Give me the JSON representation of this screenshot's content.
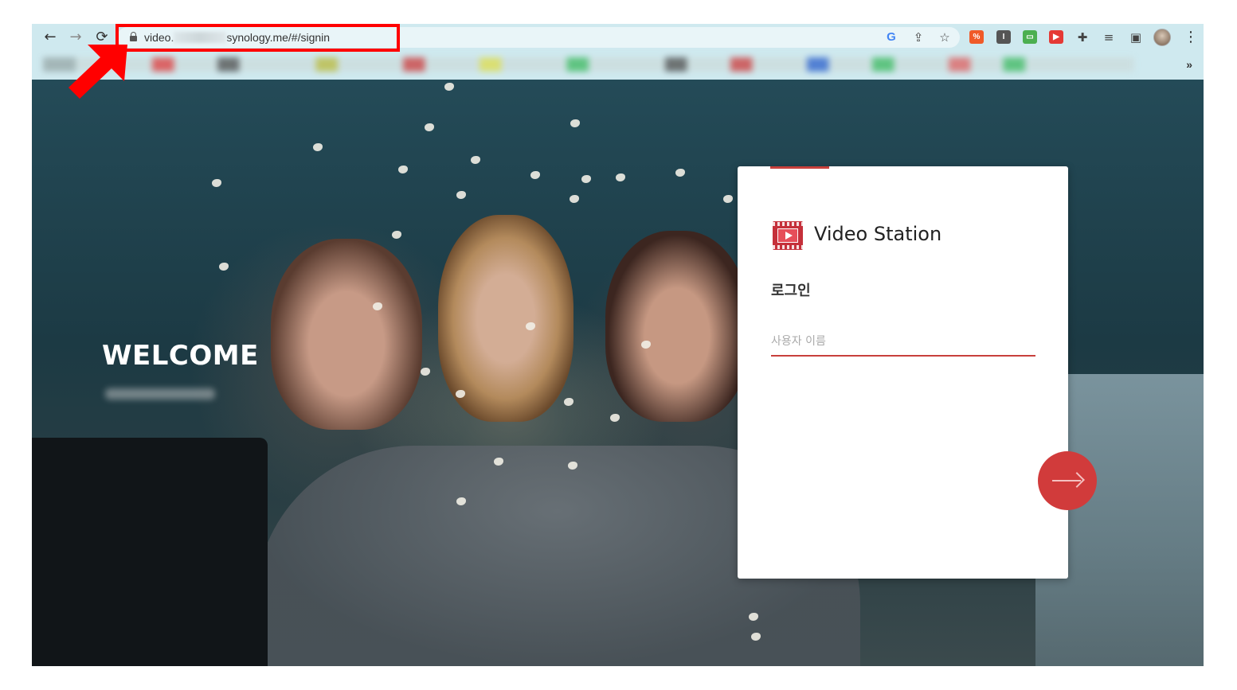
{
  "browser": {
    "url_prefix": "video.",
    "url_suffix": "synology.me/#/signin",
    "nav": {
      "back": "←",
      "forward": "→",
      "reload": "⟳"
    },
    "omnibox_icons": [
      "google-icon",
      "share-icon",
      "star-icon"
    ],
    "extensions": [
      {
        "name": "extension-icon-1",
        "label": "%",
        "color": "#f05a28"
      },
      {
        "name": "extension-icon-2",
        "label": "I",
        "color": "#555555"
      },
      {
        "name": "extension-icon-3",
        "label": "▭",
        "color": "#4caf50"
      },
      {
        "name": "extension-icon-4",
        "label": "▶",
        "color": "#e53935"
      }
    ],
    "bookmark_more": "»",
    "menu": "⋮"
  },
  "page": {
    "welcome": "WELCOME"
  },
  "login": {
    "app_name": "Video Station",
    "heading": "로그인",
    "username_placeholder": "사용자 이름",
    "accent_color": "#c8403c",
    "submit_color": "#d13b3b"
  },
  "annotation": {
    "box_color": "#ff0000"
  }
}
